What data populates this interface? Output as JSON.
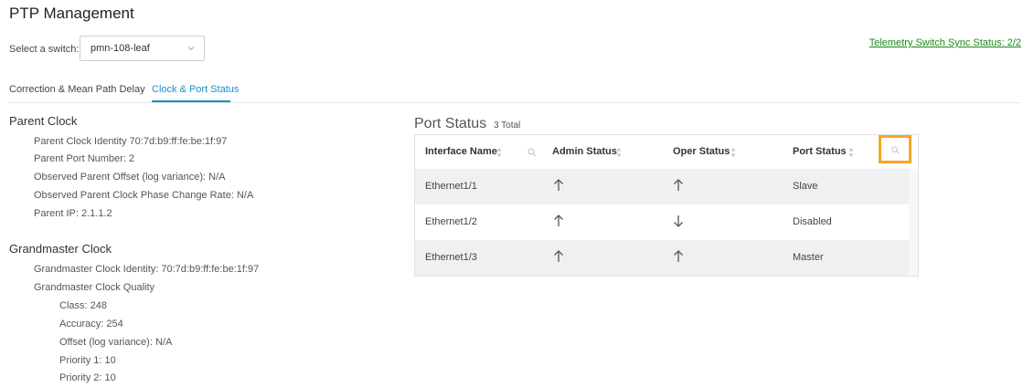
{
  "page": {
    "title": "PTP Management"
  },
  "switch": {
    "label": "Select a switch:",
    "value": "pmn-108-leaf"
  },
  "telemetry": {
    "text": "Telemetry Switch Sync Status: 2/2",
    "color": "#1a8a1a"
  },
  "tabs": [
    {
      "label": "Correction & Mean Path Delay",
      "active": false
    },
    {
      "label": "Clock & Port Status",
      "active": true
    }
  ],
  "parent_clock": {
    "title": "Parent Clock",
    "lines": [
      "Parent Clock Identity 70:7d:b9:ff:fe:be:1f:97",
      "Parent Port Number: 2",
      "Observed Parent Offset (log variance): N/A",
      "Observed Parent Clock Phase Change Rate: N/A",
      "Parent IP: 2.1.1.2"
    ]
  },
  "grandmaster_clock": {
    "title": "Grandmaster Clock",
    "identity": "Grandmaster Clock Identity: 70:7d:b9:ff:fe:be:1f:97",
    "quality_label": "Grandmaster Clock Quality",
    "quality": [
      "Class: 248",
      "Accuracy: 254",
      "Offset (log variance): N/A",
      "Priority 1: 10",
      "Priority 2: 10"
    ]
  },
  "port_status": {
    "title": "Port Status",
    "count": "3 Total",
    "columns": [
      "Interface Name",
      "Admin Status",
      "Oper Status",
      "Port Status"
    ],
    "rows": [
      {
        "interface": "Ethernet1/1",
        "admin": "up-arrow",
        "oper": "up-arrow",
        "port": "Slave"
      },
      {
        "interface": "Ethernet1/2",
        "admin": "up-arrow",
        "oper": "down-arrow",
        "port": "Disabled"
      },
      {
        "interface": "Ethernet1/3",
        "admin": "up-arrow",
        "oper": "up-arrow",
        "port": "Master"
      }
    ]
  },
  "colors": {
    "accent": "#1c8ec7",
    "highlight": "#f5a623",
    "row_shade": "#f0f0f0"
  }
}
